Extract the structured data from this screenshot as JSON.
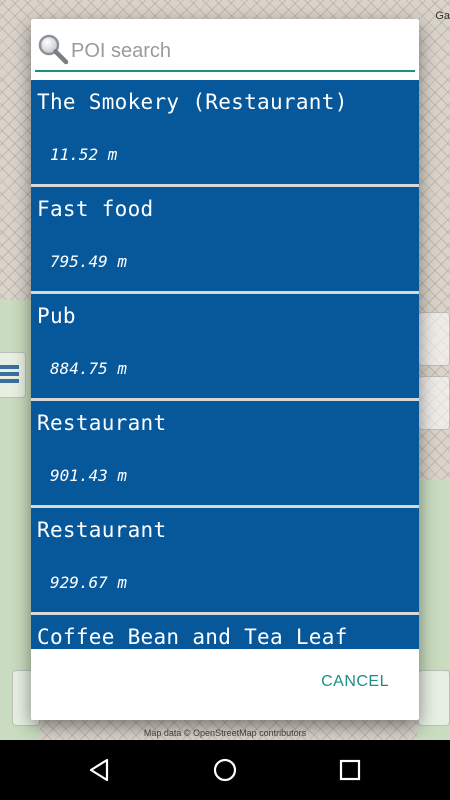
{
  "map": {
    "attribution": "Map data © OpenStreetMap contributors",
    "corner_label": "Ga"
  },
  "search": {
    "placeholder": "POI search",
    "value": ""
  },
  "poi_list": [
    {
      "name": "The Smokery (Restaurant)",
      "distance": "11.52 m"
    },
    {
      "name": "Fast food",
      "distance": "795.49 m"
    },
    {
      "name": "Pub",
      "distance": "884.75 m"
    },
    {
      "name": "Restaurant",
      "distance": "901.43 m"
    },
    {
      "name": "Restaurant",
      "distance": "929.67 m"
    },
    {
      "name": "Coffee Bean and Tea Leaf",
      "distance": ""
    }
  ],
  "dialog": {
    "cancel_label": "CANCEL"
  },
  "nav": {
    "icons": [
      "back-icon",
      "home-icon",
      "recents-icon"
    ]
  },
  "colors": {
    "list_item_bg": "#07589b",
    "accent": "#1a8f84",
    "nav_bg": "#000000"
  }
}
